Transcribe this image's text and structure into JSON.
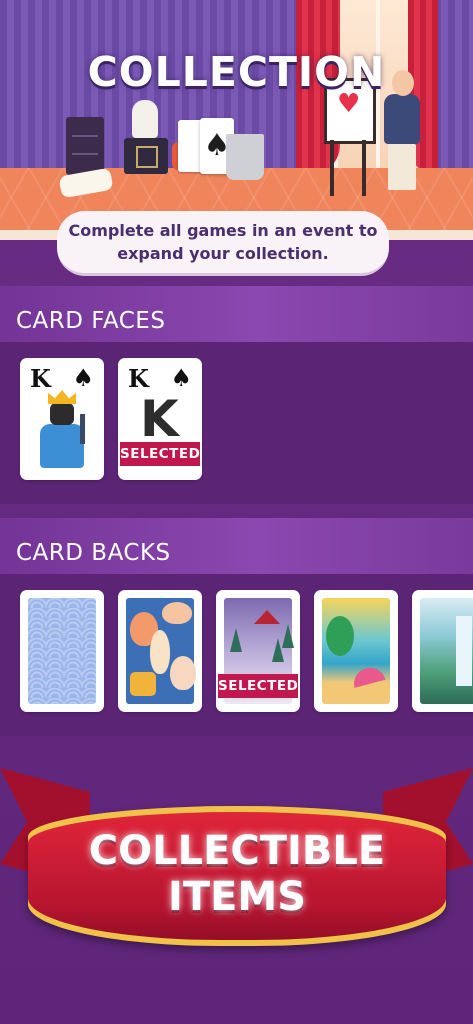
{
  "hero": {
    "title": "COLLECTION",
    "info_text": "Complete all games in an event to expand your collection."
  },
  "card_faces": {
    "header": "CARD FACES",
    "items": [
      {
        "rank": "K",
        "suit": "♠",
        "style": "king-character",
        "selected": false
      },
      {
        "rank": "K",
        "suit": "♠",
        "style": "classic-k",
        "selected": true,
        "badge": "SELECTED"
      }
    ]
  },
  "card_backs": {
    "header": "CARD BACKS",
    "items": [
      {
        "style": "blue-wave-pattern",
        "selected": false
      },
      {
        "style": "seashells",
        "selected": false
      },
      {
        "style": "winter-cabin",
        "selected": true,
        "badge": "SELECTED"
      },
      {
        "style": "beach",
        "selected": false
      },
      {
        "style": "waterfall-forest",
        "selected": false
      }
    ]
  },
  "banner": {
    "line1": "COLLECTIBLE",
    "line2": "ITEMS"
  },
  "colors": {
    "background": "#6a2d86",
    "section_header": "#8a48b0",
    "selected_badge": "#c2164e",
    "banner_red": "#e2263a",
    "banner_gold": "#f0c24a"
  }
}
